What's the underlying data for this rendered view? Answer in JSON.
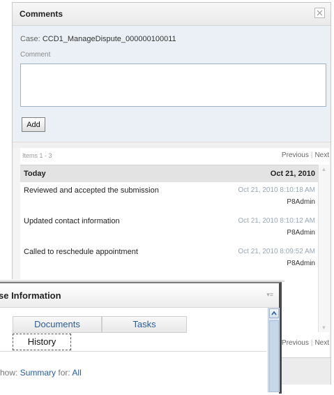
{
  "comments_dialog": {
    "title": "Comments",
    "case_label": "Case:",
    "case_value": "CCD1_ManageDispute_000000100011",
    "comment_label": "Comment",
    "comment_value": "",
    "add_label": "Add",
    "items_label": "Items 1 - 3",
    "pager": {
      "previous": "Previous",
      "next": "Next",
      "sep": "|"
    },
    "day_group": {
      "label": "Today",
      "date": "Oct 21, 2010"
    },
    "entries": [
      {
        "text": "Reviewed and accepted the submission",
        "timestamp": "Oct 21, 2010 8:10:18 AM",
        "user": "P8Admin"
      },
      {
        "text": "Updated contact information",
        "timestamp": "Oct 21, 2010 8:10:12 AM",
        "user": "P8Admin"
      },
      {
        "text": "Called to reschedule appointment",
        "timestamp": "Oct 21, 2010 8:09:52 AM",
        "user": "P8Admin"
      }
    ]
  },
  "case_info": {
    "title": "se Information",
    "tabs": [
      {
        "label": "Documents"
      },
      {
        "label": "Tasks"
      },
      {
        "label": "History"
      }
    ],
    "show_prefix": "how:",
    "show_value": "Summary",
    "for_prefix": "for:",
    "for_value": "All"
  },
  "colors": {
    "link": "#2c5d97",
    "form_bg": "#eaf0f6",
    "timestamp": "#9aa7b5"
  },
  "icons": {
    "close": "close-icon",
    "menu": "menu-icon",
    "scroll_up": "chevron-up-icon",
    "scroll_down": "chevron-down-icon"
  }
}
